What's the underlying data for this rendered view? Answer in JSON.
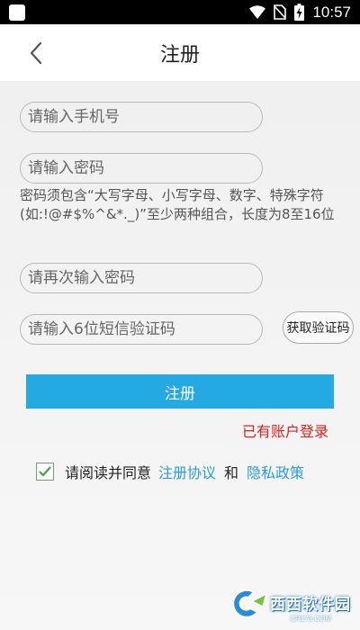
{
  "status_bar": {
    "time": "10:57",
    "icons": [
      "app-square-icon",
      "wifi-icon",
      "no-sim-icon",
      "battery-charging-icon"
    ]
  },
  "header": {
    "title": "注册",
    "back_icon": "chevron-left-icon"
  },
  "form": {
    "phone_placeholder": "请输入手机号",
    "password_placeholder": "请输入密码",
    "password_hint": "密码须包含“大写字母、小写字母、数字、特殊字符(如:!@#$%^&*._)”至少两种组合，长度为8至16位",
    "confirm_placeholder": "请再次输入密码",
    "sms_placeholder": "请输入6位短信验证码",
    "get_code_label": "获取验证码",
    "register_label": "注册",
    "login_link": "已有账户登录"
  },
  "agreement": {
    "checked": true,
    "prefix": "请阅读并同意",
    "terms_link": "注册协议",
    "and": "和",
    "privacy_link": "隐私政策"
  },
  "watermark": {
    "text": "西西软件园",
    "sub": "CR173.COM"
  },
  "colors": {
    "accent_blue": "#25a9e2",
    "link_blue": "#2a9bd8",
    "login_red": "#e0201b",
    "background": "#f0f0f0"
  }
}
